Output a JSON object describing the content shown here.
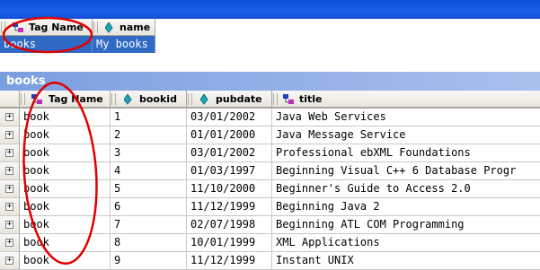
{
  "window": {
    "title": ""
  },
  "upper": {
    "headers": [
      {
        "label": "Tag Name",
        "icon": "tag-icon"
      },
      {
        "label": "name",
        "icon": "attribute-icon"
      }
    ],
    "row": {
      "tag": "books",
      "name": "My books"
    }
  },
  "section": {
    "title": "books"
  },
  "lower": {
    "headers": [
      {
        "label": "Tag Name",
        "icon": "tag-icon"
      },
      {
        "label": "bookid",
        "icon": "attribute-icon"
      },
      {
        "label": "pubdate",
        "icon": "attribute-icon"
      },
      {
        "label": "title",
        "icon": "tag-icon"
      }
    ],
    "rows": [
      {
        "tag": "book",
        "bookid": "1",
        "pubdate": "03/01/2002",
        "title": "Java Web Services"
      },
      {
        "tag": "book",
        "bookid": "2",
        "pubdate": "01/01/2000",
        "title": "Java Message Service"
      },
      {
        "tag": "book",
        "bookid": "3",
        "pubdate": "03/01/2002",
        "title": "Professional ebXML Foundations"
      },
      {
        "tag": "book",
        "bookid": "4",
        "pubdate": "01/03/1997",
        "title": "Beginning Visual C++ 6 Database Progr"
      },
      {
        "tag": "book",
        "bookid": "5",
        "pubdate": "11/10/2000",
        "title": "Beginner's Guide to Access 2.0"
      },
      {
        "tag": "book",
        "bookid": "6",
        "pubdate": "11/12/1999",
        "title": "Beginning Java 2"
      },
      {
        "tag": "book",
        "bookid": "7",
        "pubdate": "02/07/1998",
        "title": "Beginning ATL COM Programming"
      },
      {
        "tag": "book",
        "bookid": "8",
        "pubdate": "10/01/1999",
        "title": "XML Applications"
      },
      {
        "tag": "book",
        "bookid": "9",
        "pubdate": "11/12/1999",
        "title": "Instant UNIX"
      }
    ]
  },
  "colors": {
    "selection": "#316ac5",
    "annotation": "#e00000",
    "section_bar": "#7b9ee0"
  }
}
